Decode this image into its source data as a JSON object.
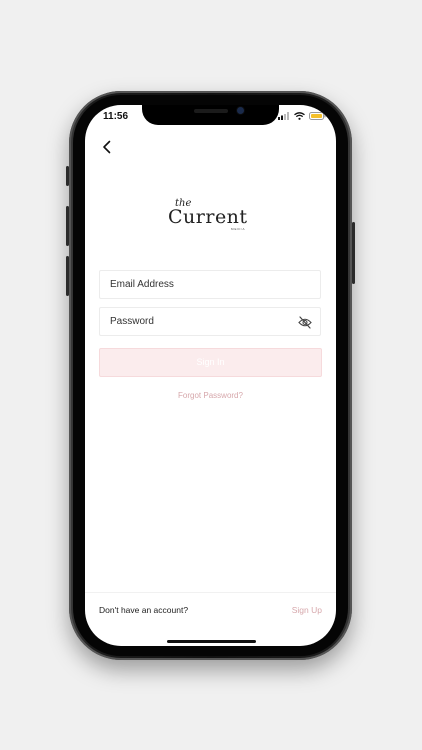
{
  "status_bar": {
    "time": "11:56"
  },
  "brand": {
    "the": "the",
    "name": "Current",
    "sub": "MEDIA"
  },
  "form": {
    "email_placeholder": "Email Address",
    "password_placeholder": "Password",
    "sign_in_label": "Sign In",
    "forgot_label": "Forgot Password?"
  },
  "footer": {
    "no_account_text": "Don't have an account?",
    "sign_up_label": "Sign Up"
  },
  "colors": {
    "accent": "#d6a7ab",
    "button_bg": "#fbeced",
    "background": "#f0f0f0"
  },
  "icons": {
    "back": "chevron-left-icon",
    "password_toggle": "eye-slash-icon",
    "signal": "cellular-signal-icon",
    "wifi": "wifi-icon",
    "battery": "battery-icon"
  }
}
